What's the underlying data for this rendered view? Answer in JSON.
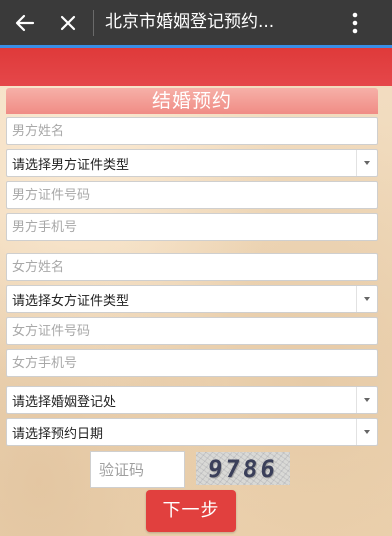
{
  "app_bar": {
    "title": "北京市婚姻登记预约..."
  },
  "icons": {
    "back": "back-arrow-icon",
    "close": "close-icon",
    "menu": "more-vertical-icon",
    "dropdown": "chevron-down-icon"
  },
  "colors": {
    "app_bar": "#3a3a3a",
    "accent_line": "#3a8ee6",
    "brand_red": "#e1403e",
    "banner_pink": "#f08c85",
    "background": "#f0d9bd"
  },
  "form": {
    "header": "结婚预约",
    "groom": {
      "name_placeholder": "男方姓名",
      "id_type": "请选择男方证件类型",
      "id_number_placeholder": "男方证件号码",
      "phone_placeholder": "男方手机号"
    },
    "bride": {
      "name_placeholder": "女方姓名",
      "id_type": "请选择女方证件类型",
      "id_number_placeholder": "女方证件号码",
      "phone_placeholder": "女方手机号"
    },
    "office": "请选择婚姻登记处",
    "date": "请选择预约日期",
    "captcha_placeholder": "验证码",
    "captcha_code": "9786",
    "next_label": "下一步"
  }
}
